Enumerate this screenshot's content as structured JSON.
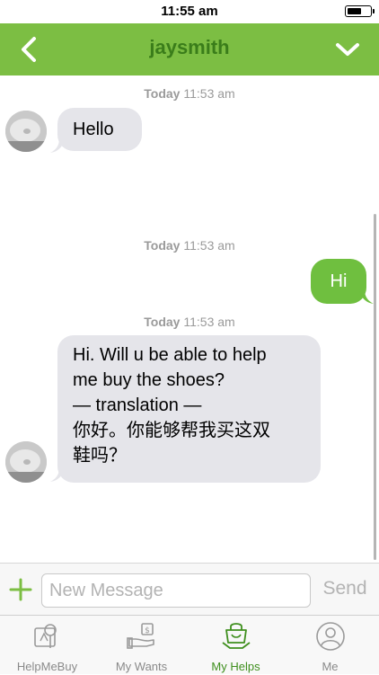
{
  "status_bar": {
    "time": "11:55 am",
    "battery_level": 0.68
  },
  "nav": {
    "title": "jaysmith",
    "back_icon": "chevron-left-icon",
    "menu_icon": "chevron-down-icon"
  },
  "colors": {
    "accent": "#7cbe43",
    "title": "#3a7d1a",
    "outgoing_bubble": "#6fbf3f",
    "incoming_bubble": "#e5e5ea",
    "active_tab": "#3f8f1e"
  },
  "messages": [
    {
      "timestamp_day": "Today",
      "timestamp_time": "11:53 am",
      "direction": "incoming",
      "text": "Hello"
    },
    {
      "timestamp_day": "Today",
      "timestamp_time": "11:53 am",
      "direction": "outgoing",
      "text": "Hi"
    },
    {
      "timestamp_day": "Today",
      "timestamp_time": "11:53 am",
      "direction": "incoming",
      "lines": [
        "Hi. Will u be able to help",
        "me buy the shoes?",
        "— translation —",
        "你好。你能够帮我买这双",
        "鞋吗？"
      ]
    }
  ],
  "composer": {
    "placeholder": "New Message",
    "send_label": "Send",
    "add_icon": "plus-icon"
  },
  "tabs": [
    {
      "label": "HelpMeBuy",
      "icon": "map-pin-icon",
      "active": false
    },
    {
      "label": "My Wants",
      "icon": "hand-money-icon",
      "active": false
    },
    {
      "label": "My Helps",
      "icon": "shopping-bag-icon",
      "active": true
    },
    {
      "label": "Me",
      "icon": "user-icon",
      "active": false
    }
  ]
}
